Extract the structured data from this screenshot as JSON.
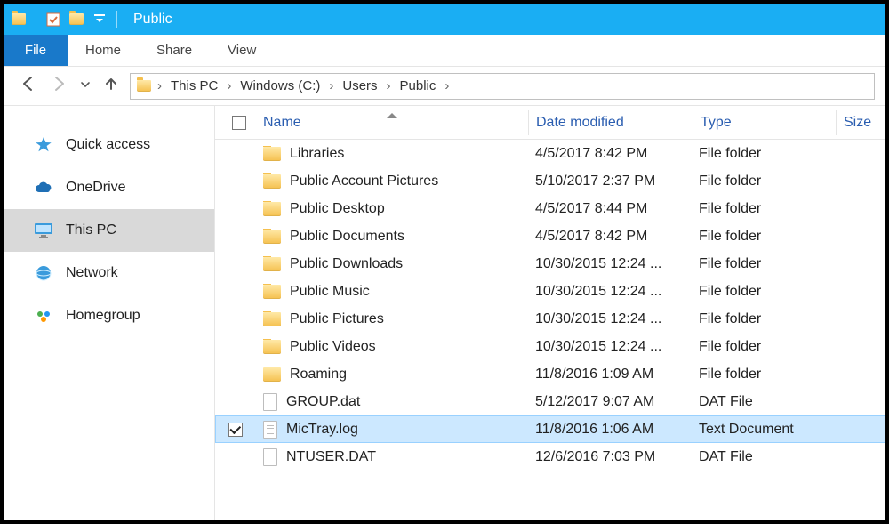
{
  "titlebar": {
    "window_title": "Public",
    "qat_icons": [
      "folder-icon",
      "properties-icon",
      "folder-icon",
      "dropdown-icon"
    ]
  },
  "ribbon": {
    "file_label": "File",
    "tabs": [
      "Home",
      "Share",
      "View"
    ]
  },
  "address_bar": {
    "crumbs": [
      "This PC",
      "Windows (C:)",
      "Users",
      "Public"
    ]
  },
  "nav_pane": {
    "items": [
      {
        "label": "Quick access",
        "icon": "star-icon",
        "selected": false
      },
      {
        "label": "OneDrive",
        "icon": "cloud-icon",
        "selected": false
      },
      {
        "label": "This PC",
        "icon": "monitor-icon",
        "selected": true
      },
      {
        "label": "Network",
        "icon": "network-icon",
        "selected": false
      },
      {
        "label": "Homegroup",
        "icon": "homegroup-icon",
        "selected": false
      }
    ]
  },
  "columns": {
    "name": "Name",
    "date": "Date modified",
    "type": "Type",
    "size": "Size"
  },
  "files": [
    {
      "name": "Libraries",
      "date": "4/5/2017 8:42 PM",
      "type": "File folder",
      "kind": "folder",
      "selected": false
    },
    {
      "name": "Public Account Pictures",
      "date": "5/10/2017 2:37 PM",
      "type": "File folder",
      "kind": "folder",
      "selected": false
    },
    {
      "name": "Public Desktop",
      "date": "4/5/2017 8:44 PM",
      "type": "File folder",
      "kind": "folder",
      "selected": false
    },
    {
      "name": "Public Documents",
      "date": "4/5/2017 8:42 PM",
      "type": "File folder",
      "kind": "folder",
      "selected": false
    },
    {
      "name": "Public Downloads",
      "date": "10/30/2015 12:24 ...",
      "type": "File folder",
      "kind": "folder",
      "selected": false
    },
    {
      "name": "Public Music",
      "date": "10/30/2015 12:24 ...",
      "type": "File folder",
      "kind": "folder",
      "selected": false
    },
    {
      "name": "Public Pictures",
      "date": "10/30/2015 12:24 ...",
      "type": "File folder",
      "kind": "folder",
      "selected": false
    },
    {
      "name": "Public Videos",
      "date": "10/30/2015 12:24 ...",
      "type": "File folder",
      "kind": "folder",
      "selected": false
    },
    {
      "name": "Roaming",
      "date": "11/8/2016 1:09 AM",
      "type": "File folder",
      "kind": "folder",
      "selected": false
    },
    {
      "name": "GROUP.dat",
      "date": "5/12/2017 9:07 AM",
      "type": "DAT File",
      "kind": "file",
      "selected": false
    },
    {
      "name": "MicTray.log",
      "date": "11/8/2016 1:06 AM",
      "type": "Text Document",
      "kind": "text",
      "selected": true
    },
    {
      "name": "NTUSER.DAT",
      "date": "12/6/2016 7:03 PM",
      "type": "DAT File",
      "kind": "file",
      "selected": false
    }
  ]
}
